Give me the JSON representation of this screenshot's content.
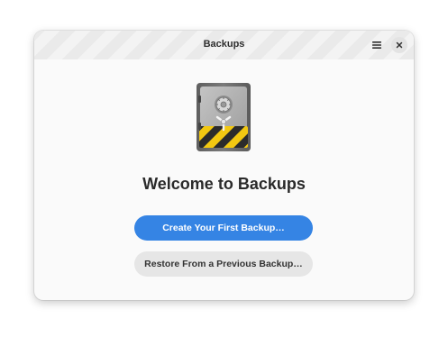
{
  "window": {
    "title": "Backups"
  },
  "header": {
    "menu_icon": "hamburger-menu-icon",
    "close_icon": "close-icon"
  },
  "main": {
    "app_icon": "vault-safe-icon",
    "welcome_text": "Welcome to Backups",
    "primary_button_label": "Create Your First Backup…",
    "secondary_button_label": "Restore From a Previous Backup…"
  },
  "colors": {
    "accent": "#3584e4",
    "secondary_button": "#e6e6e6",
    "window_bg": "#fafafa"
  }
}
